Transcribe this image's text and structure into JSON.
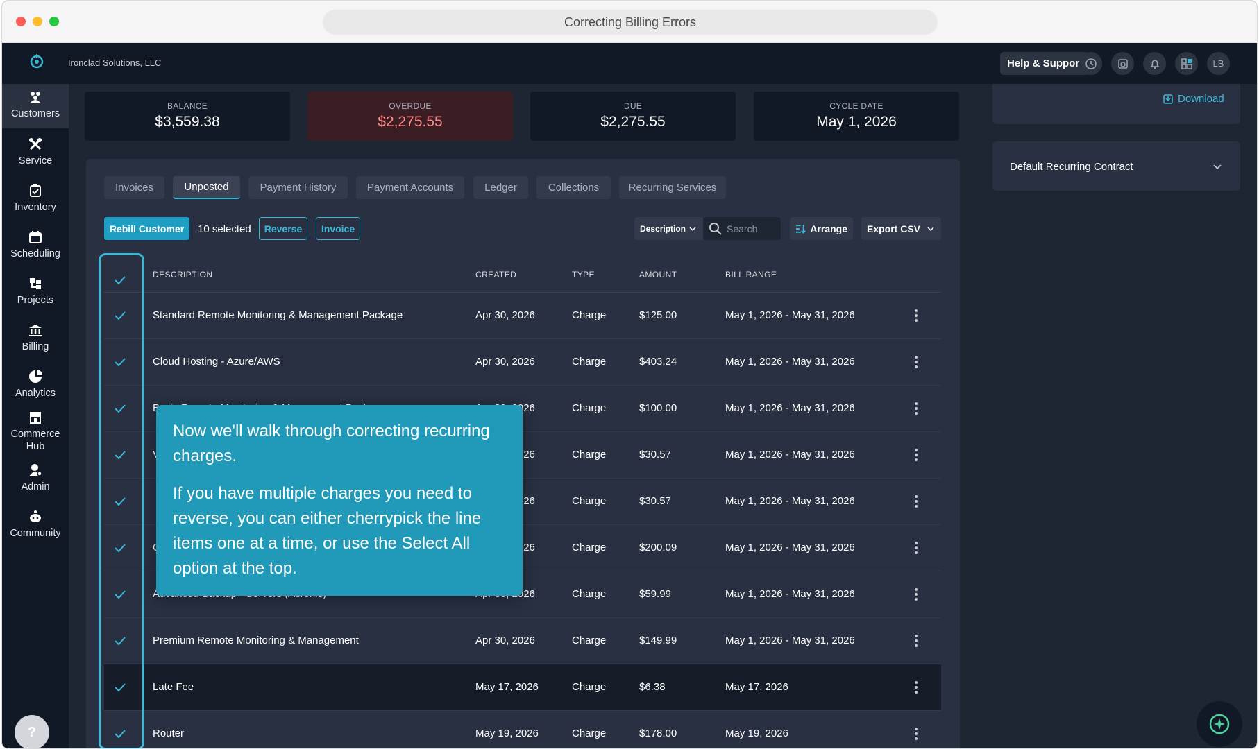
{
  "window": {
    "title": "Correcting Billing Errors"
  },
  "appbar": {
    "company": "Ironclad Solutions, LLC",
    "help_label": "Help & Support",
    "avatar_initials": "LB"
  },
  "sidebar": {
    "items": [
      {
        "label": "Customers",
        "icon": "customers-icon"
      },
      {
        "label": "Service",
        "icon": "service-icon"
      },
      {
        "label": "Inventory",
        "icon": "inventory-icon"
      },
      {
        "label": "Scheduling",
        "icon": "calendar-icon"
      },
      {
        "label": "Projects",
        "icon": "projects-icon"
      },
      {
        "label": "Billing",
        "icon": "bank-icon"
      },
      {
        "label": "Analytics",
        "icon": "pie-chart-icon"
      },
      {
        "label": "Commerce Hub",
        "icon": "store-icon"
      },
      {
        "label": "Admin",
        "icon": "admin-icon"
      },
      {
        "label": "Community",
        "icon": "community-icon"
      }
    ],
    "help_fab": "?"
  },
  "stats": [
    {
      "label": "BALANCE",
      "value": "$3,559.38"
    },
    {
      "label": "OVERDUE",
      "value": "$2,275.55"
    },
    {
      "label": "DUE",
      "value": "$2,275.55"
    },
    {
      "label": "CYCLE DATE",
      "value": "May 1, 2026"
    }
  ],
  "tabs": [
    "Invoices",
    "Unposted",
    "Payment History",
    "Payment Accounts",
    "Ledger",
    "Collections",
    "Recurring Services"
  ],
  "active_tab": "Unposted",
  "toolbar": {
    "rebill_label": "Rebill Customer",
    "selected_text": "10 selected",
    "reverse_label": "Reverse",
    "invoice_label": "Invoice",
    "filter_label": "Description",
    "search_placeholder": "Search",
    "arrange_label": "Arrange",
    "export_label": "Export CSV"
  },
  "table": {
    "headers": [
      "DESCRIPTION",
      "CREATED",
      "TYPE",
      "AMOUNT",
      "BILL RANGE"
    ],
    "rows": [
      {
        "description": "Standard Remote Monitoring & Management Package",
        "created": "Apr 30, 2026",
        "type": "Charge",
        "amount": "$125.00",
        "range": "May 1, 2026 - May 31, 2026"
      },
      {
        "description": "Cloud Hosting - Azure/AWS",
        "created": "Apr 30, 2026",
        "type": "Charge",
        "amount": "$403.24",
        "range": "May 1, 2026 - May 31, 2026"
      },
      {
        "description": "Basic Remote Monitoring & Management Package",
        "created": "Apr 30, 2026",
        "type": "Charge",
        "amount": "$100.00",
        "range": "May 1, 2026 - May 31, 2026"
      },
      {
        "description": "V",
        "created": "Apr 30, 2026",
        "type": "Charge",
        "amount": "$30.57",
        "range": "May 1, 2026 - May 31, 2026"
      },
      {
        "description": "",
        "created": "Apr 30, 2026",
        "type": "Charge",
        "amount": "$30.57",
        "range": "May 1, 2026 - May 31, 2026"
      },
      {
        "description": "C",
        "created": "Apr 30, 2026",
        "type": "Charge",
        "amount": "$200.09",
        "range": "May 1, 2026 - May 31, 2026"
      },
      {
        "description": "Advanced Backup - Servers (Acronis)",
        "created": "Apr 30, 2026",
        "type": "Charge",
        "amount": "$59.99",
        "range": "May 1, 2026 - May 31, 2026"
      },
      {
        "description": "Premium Remote Monitoring & Management",
        "created": "Apr 30, 2026",
        "type": "Charge",
        "amount": "$149.99",
        "range": "May 1, 2026 - May 31, 2026"
      },
      {
        "description": "Late Fee",
        "created": "May 17, 2026",
        "type": "Charge",
        "amount": "$6.38",
        "range": "May 17, 2026"
      },
      {
        "description": "Router",
        "created": "May 19, 2026",
        "type": "Charge",
        "amount": "$178.00",
        "range": "May 19, 2026"
      }
    ]
  },
  "tooltip": {
    "p1": "Now we'll walk through correcting recurring charges.",
    "p2": "If you have multiple charges you need to reverse, you can either cherrypick the line items one at a time, or use the Select All option at the top."
  },
  "right_panel": {
    "download_label": "Download",
    "contract_label": "Default Recurring Contract"
  },
  "colors": {
    "accent": "#3ab8d8",
    "primary_button": "#1e9ec2",
    "tooltip_bg": "#2199b8",
    "overdue": "#ff8a8a"
  }
}
